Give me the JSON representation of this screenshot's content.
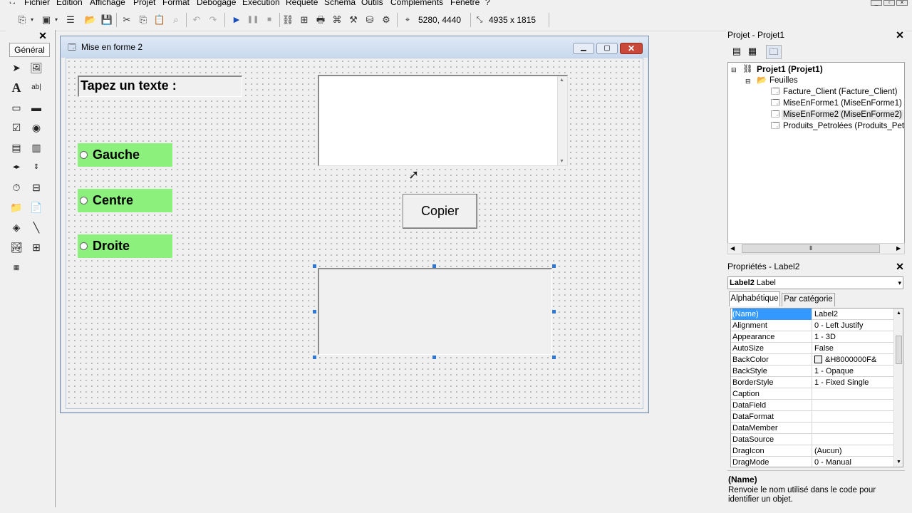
{
  "menu": {
    "items": [
      "Fichier",
      "Edition",
      "Affichage",
      "Projet",
      "Format",
      "Debogage",
      "Execution",
      "Requete",
      "Schema",
      "Outils",
      "Complements",
      "Fenetre",
      "?"
    ]
  },
  "toolbar": {
    "position_readout": "5280, 4440",
    "size_readout": "4935 x 1815"
  },
  "toolbox": {
    "tab_label": "Général"
  },
  "form_window": {
    "title": "Mise en forme 2",
    "label_prompt": "Tapez un texte :",
    "options": [
      "Gauche",
      "Centre",
      "Droite"
    ],
    "copy_button": "Copier"
  },
  "project_panel": {
    "title": "Projet - Projet1",
    "root": "Projet1 (Projet1)",
    "folder": "Feuilles",
    "forms": [
      "Facture_Client (Facture_Client)",
      "MiseEnForme1 (MiseEnForme1)",
      "MiseEnForme2 (MiseEnForme2)",
      "Produits_Petrolées (Produits_Petrol"
    ]
  },
  "properties_panel": {
    "title": "Propriétés - Label2",
    "object_name": "Label2",
    "object_type": "Label",
    "tabs": [
      "Alphabétique",
      "Par catégorie"
    ],
    "rows": [
      {
        "name": "(Name)",
        "value": "Label2"
      },
      {
        "name": "Alignment",
        "value": "0 - Left Justify"
      },
      {
        "name": "Appearance",
        "value": "1 - 3D"
      },
      {
        "name": "AutoSize",
        "value": "False"
      },
      {
        "name": "BackColor",
        "value": "&H8000000F&"
      },
      {
        "name": "BackStyle",
        "value": "1 - Opaque"
      },
      {
        "name": "BorderStyle",
        "value": "1 - Fixed Single"
      },
      {
        "name": "Caption",
        "value": ""
      },
      {
        "name": "DataField",
        "value": ""
      },
      {
        "name": "DataFormat",
        "value": ""
      },
      {
        "name": "DataMember",
        "value": ""
      },
      {
        "name": "DataSource",
        "value": ""
      },
      {
        "name": "DragIcon",
        "value": "(Aucun)"
      },
      {
        "name": "DragMode",
        "value": "0 - Manual"
      }
    ],
    "desc_title": "(Name)",
    "desc_text": "Renvoie le nom utilisé dans le code pour identifier un objet."
  },
  "colors": {
    "option_bg": "#8cf07d",
    "selection": "#3399ff"
  }
}
